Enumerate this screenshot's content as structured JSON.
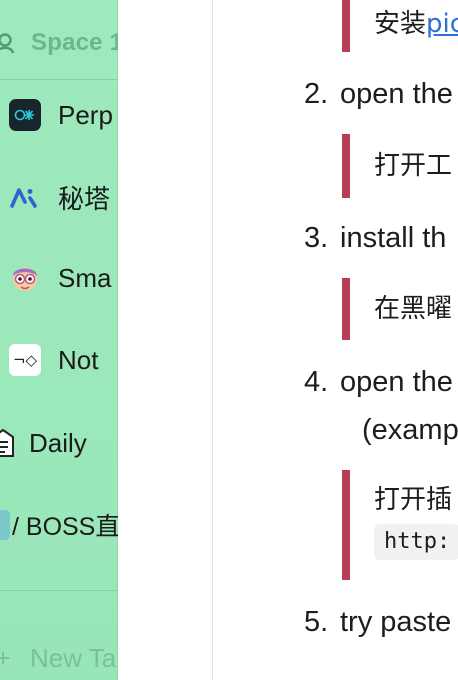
{
  "sidebar": {
    "space": {
      "icon": "profile-icon",
      "name": "Space 1"
    },
    "tabs": [
      {
        "icon": "perplexity-icon",
        "label": "Perp"
      },
      {
        "icon": "metaso-icon",
        "label": "秘塔"
      },
      {
        "icon": "smart-avatar-icon",
        "label": "Sma"
      },
      {
        "icon": "notion-icon",
        "label": "Not"
      },
      {
        "icon": "daily-icon",
        "label": "Daily"
      },
      {
        "icon": "boss-icon",
        "label": "/ BOSS直"
      }
    ],
    "new_tab": {
      "icon": "plus-icon",
      "label": "New Ta"
    }
  },
  "doc": {
    "quote1": {
      "text": "安装",
      "link": "pic"
    },
    "step2": {
      "num": "2.",
      "text": "open the"
    },
    "quote2": {
      "text": "打开工"
    },
    "step3": {
      "num": "3.",
      "text": "install th"
    },
    "quote3": {
      "text": "在黑曜"
    },
    "step4": {
      "num": "4.",
      "text": "open the",
      "continuation": "(examp"
    },
    "quote4": {
      "text": "打开插",
      "code": "http:"
    },
    "step5": {
      "num": "5.",
      "text": "try paste"
    }
  },
  "colors": {
    "sidebar_bg": "#9ee9bd",
    "blockquote_border": "#b83e57",
    "link": "#2f6fd6"
  }
}
